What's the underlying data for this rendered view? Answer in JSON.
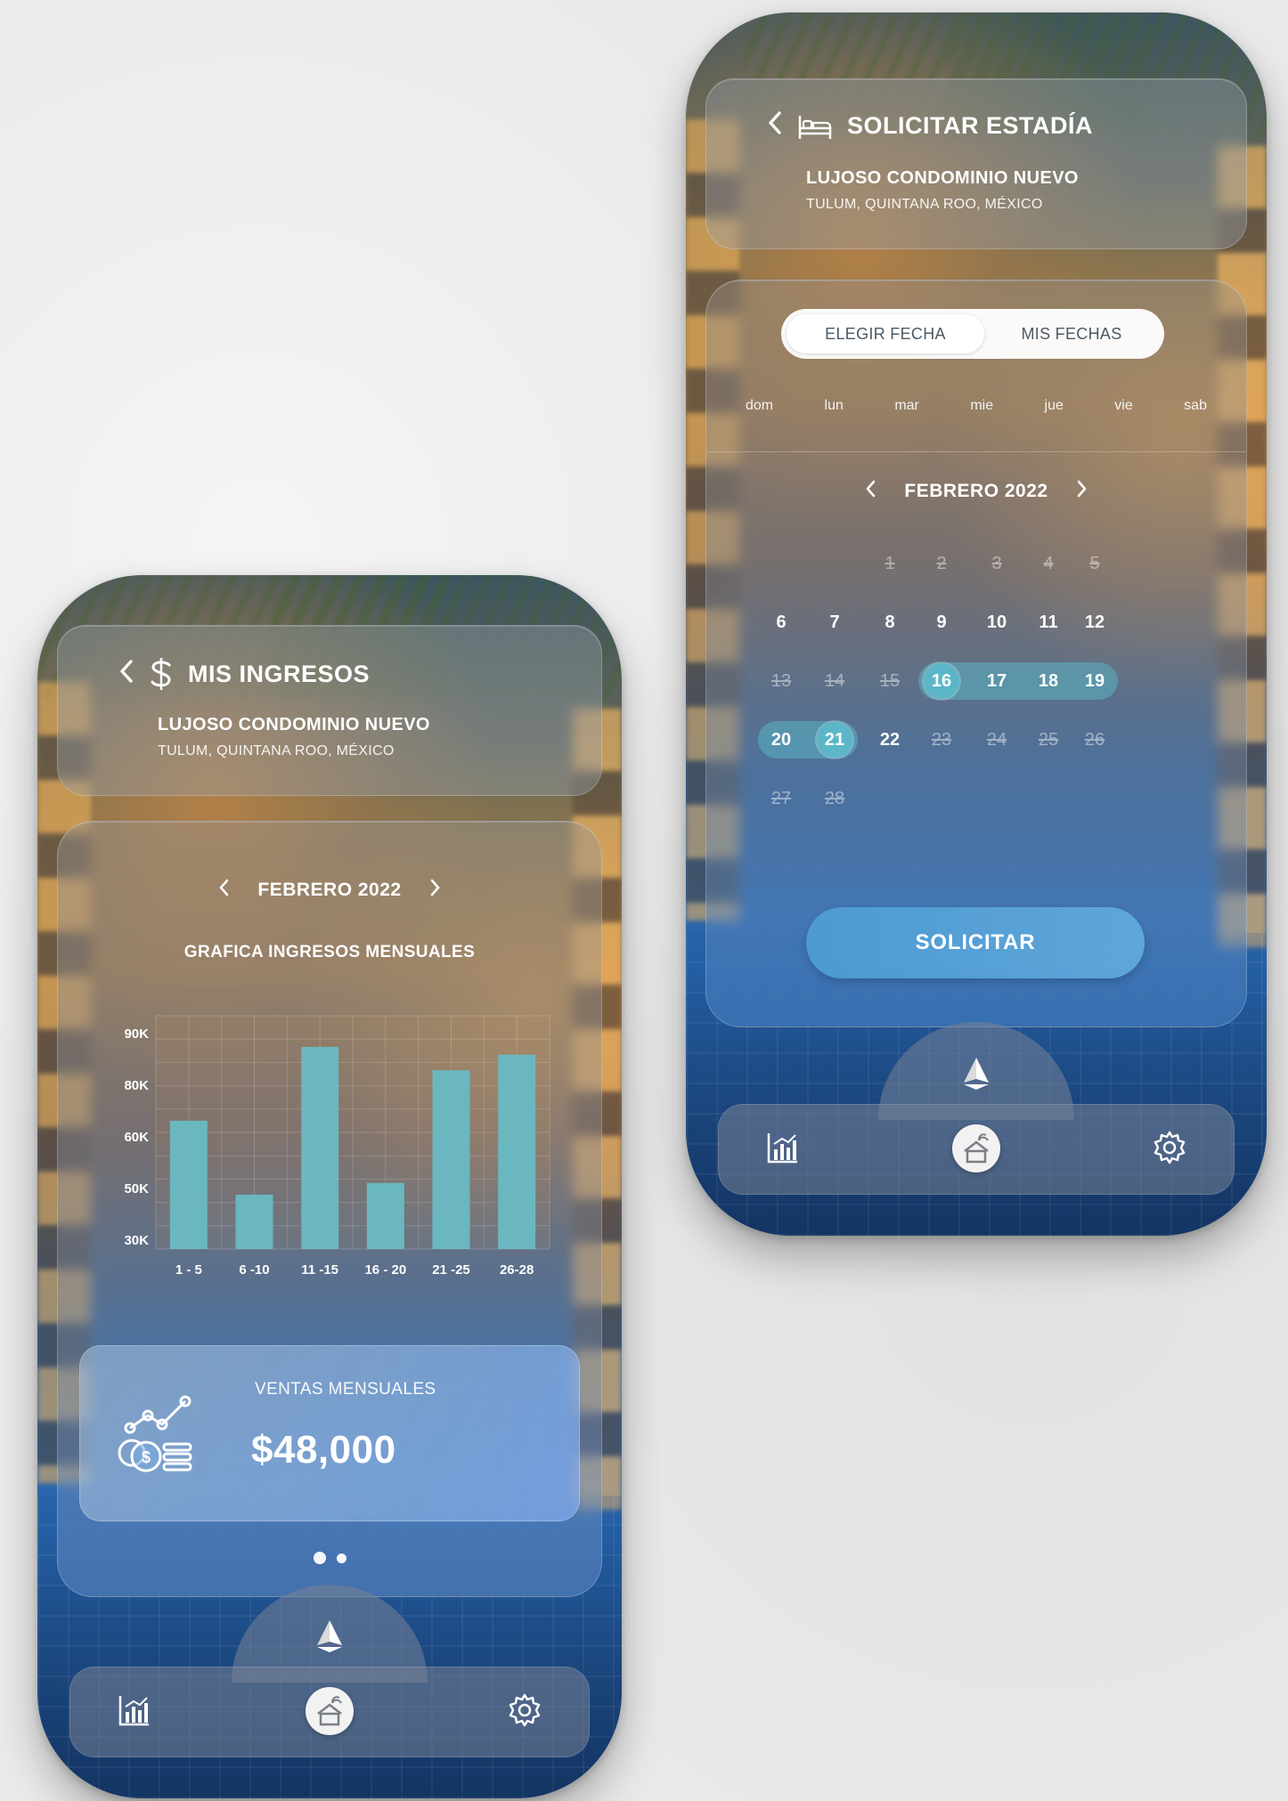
{
  "left_screen": {
    "header": {
      "title": "MIS INGRESOS",
      "subtitle": "LUJOSO CONDOMINIO NUEVO",
      "location": "TULUM, QUINTANA ROO, MÉXICO"
    },
    "month": "FEBRERO 2022",
    "chart_data": {
      "type": "bar",
      "title": "GRAFICA INGRESOS MENSUALES",
      "categories": [
        "1 - 5",
        "6 -10",
        "11 -15",
        "16 - 20",
        "21 -25",
        "26-28"
      ],
      "values": [
        63000,
        44000,
        82000,
        47000,
        76000,
        80000
      ],
      "y_tick_labels": [
        "90K",
        "80K",
        "60K",
        "50K",
        "30K"
      ],
      "ylim": [
        30000,
        90000
      ],
      "grid": true,
      "bar_color": "#6bb7bf"
    },
    "sales": {
      "label": "VENTAS MENSUALES",
      "value": "$48,000"
    },
    "pagination": {
      "total": 2,
      "active": 0
    }
  },
  "right_screen": {
    "header": {
      "title": "SOLICITAR ESTADÍA",
      "subtitle": "LUJOSO CONDOMINIO NUEVO",
      "location": "TULUM, QUINTANA ROO, MÉXICO"
    },
    "tabs": [
      "ELEGIR FECHA",
      "MIS FECHAS"
    ],
    "active_tab": 0,
    "weekdays": [
      "dom",
      "lun",
      "mar",
      "mie",
      "jue",
      "vie",
      "sab"
    ],
    "month": "FEBRERO 2022",
    "calendar": {
      "first_weekday": 2,
      "days_in_month": 28,
      "unavailable": [
        1,
        2,
        3,
        4,
        5,
        13,
        14,
        15,
        23,
        24,
        25,
        26,
        27,
        28
      ],
      "selected_ranges": [
        [
          16,
          19
        ],
        [
          20,
          21
        ]
      ],
      "highlighted": [
        16,
        21
      ]
    },
    "request_button": "SOLICITAR"
  },
  "icons": {
    "back": "chevron-left-icon",
    "income": "dollar-icon",
    "stay": "bed-icon",
    "sales": "coins-chart-icon",
    "nav_stats": "bar-chart-icon",
    "nav_home": "house-palm-icon",
    "nav_settings": "gear-icon",
    "nav_top": "sail-logo-icon"
  },
  "colors": {
    "accent": "#5bb7c8",
    "bar": "#6bb7bf",
    "button": "#5aa8dc"
  }
}
